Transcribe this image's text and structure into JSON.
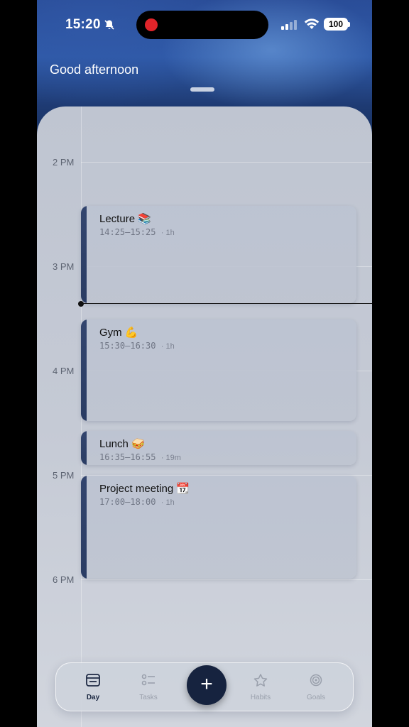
{
  "status_bar": {
    "time": "15:20",
    "battery": "100"
  },
  "header": {
    "greeting": "Good afternoon"
  },
  "timeline": {
    "hours": [
      "2 PM",
      "3 PM",
      "4 PM",
      "5 PM",
      "6 PM"
    ]
  },
  "events": [
    {
      "title": "Lecture 📚",
      "time": "14:25–15:25",
      "duration": "1h"
    },
    {
      "title": "Gym 💪",
      "time": "15:30–16:30",
      "duration": "1h"
    },
    {
      "title": "Lunch 🥪",
      "time": "16:35–16:55",
      "duration": "19m"
    },
    {
      "title": "Project meeting 📆",
      "time": "17:00–18:00",
      "duration": "1h"
    }
  ],
  "tabbar": {
    "day": "Day",
    "tasks": "Tasks",
    "habits": "Habits",
    "goals": "Goals",
    "add": "+"
  },
  "colors": {
    "accent": "#16233f",
    "recording": "#e0242a"
  }
}
